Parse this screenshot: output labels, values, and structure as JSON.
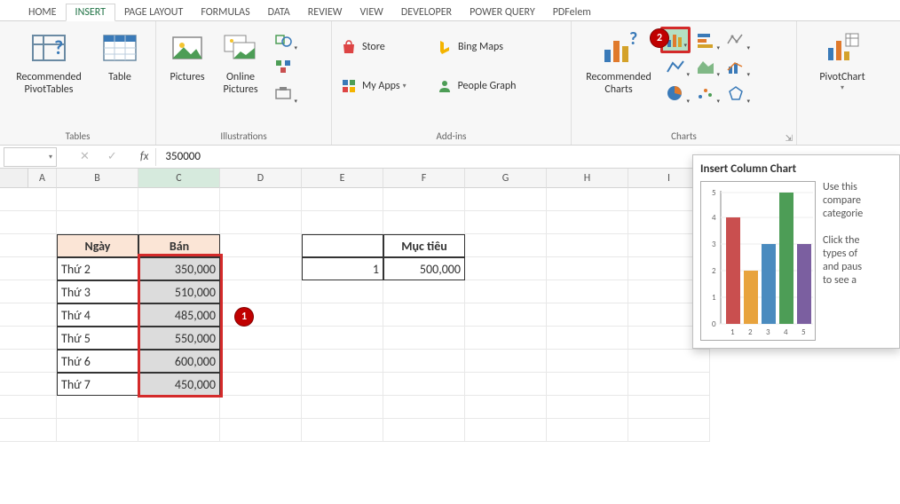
{
  "tabs": {
    "home": "HOME",
    "insert": "INSERT",
    "page_layout": "PAGE LAYOUT",
    "formulas": "FORMULAS",
    "data": "DATA",
    "review": "REVIEW",
    "view": "VIEW",
    "developer": "DEVELOPER",
    "power_query": "POWER QUERY",
    "pdfelement": "PDFelem"
  },
  "ribbon": {
    "groups": {
      "tables": "Tables",
      "illustrations": "Illustrations",
      "addins": "Add-ins",
      "charts": "Charts"
    },
    "buttons": {
      "rec_pivot": "Recommended\nPivotTables",
      "table": "Table",
      "pictures": "Pictures",
      "online_pictures": "Online\nPictures",
      "store": "Store",
      "my_apps": "My Apps",
      "bing_maps": "Bing Maps",
      "people_graph": "People Graph",
      "rec_charts": "Recommended\nCharts",
      "pivotchart": "PivotChart"
    }
  },
  "formula_bar": {
    "fx": "fx",
    "value": "350000"
  },
  "callouts": {
    "b1": "1",
    "b2": "2"
  },
  "columns": [
    "A",
    "B",
    "C",
    "D",
    "E",
    "F",
    "G",
    "H",
    "I"
  ],
  "sheet": {
    "header_day": "Ngày",
    "header_sold": "Bán",
    "rows": [
      {
        "day": "Thứ 2",
        "sold": "350,000"
      },
      {
        "day": "Thứ 3",
        "sold": "510,000"
      },
      {
        "day": "Thứ 4",
        "sold": "485,000"
      },
      {
        "day": "Thứ 5",
        "sold": "550,000"
      },
      {
        "day": "Thứ 6",
        "sold": "600,000"
      },
      {
        "day": "Thứ 7",
        "sold": "450,000"
      }
    ],
    "target_label": "Mục tiêu",
    "target_idx": "1",
    "target_val": "500,000"
  },
  "tooltip": {
    "title": "Insert Column Chart",
    "line1": "Use this",
    "line2": "compare",
    "line3": "categorie",
    "line4": "Click the",
    "line5": "types of",
    "line6": "and paus",
    "line7": "to see a"
  },
  "chart_data": {
    "type": "bar",
    "title": "Insert Column Chart",
    "categories": [
      "1",
      "2",
      "3",
      "4",
      "5"
    ],
    "values": [
      4,
      2,
      3,
      5,
      3
    ],
    "xlabel": "",
    "ylabel": "",
    "ylim": [
      0,
      5
    ]
  }
}
